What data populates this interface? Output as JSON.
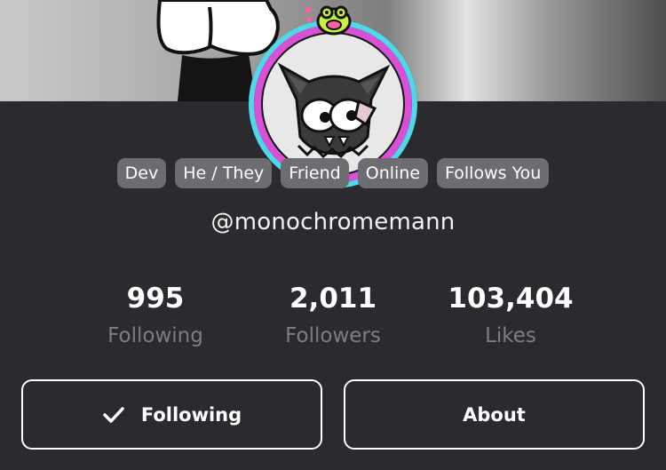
{
  "profile": {
    "tags": [
      "Dev",
      "He / They",
      "Friend",
      "Online",
      "Follows You"
    ],
    "handle": "@monochromemann",
    "stats": {
      "following": {
        "value": "995",
        "label": "Following"
      },
      "followers": {
        "value": "2,011",
        "label": "Followers"
      },
      "likes": {
        "value": "103,404",
        "label": "Likes"
      }
    }
  },
  "actions": {
    "following_label": "Following",
    "about_label": "About"
  },
  "icons": {
    "following_button": "check-icon",
    "avatar_badge": "frog-icon"
  },
  "colors": {
    "background": "#2b2a2e",
    "tag_background": "#6d6c71",
    "muted_text": "#7f7e83",
    "avatar_ring_outer": "#4fd8e8",
    "avatar_ring_inner": "#d94fd6",
    "badge_green": "#c6f23a"
  }
}
